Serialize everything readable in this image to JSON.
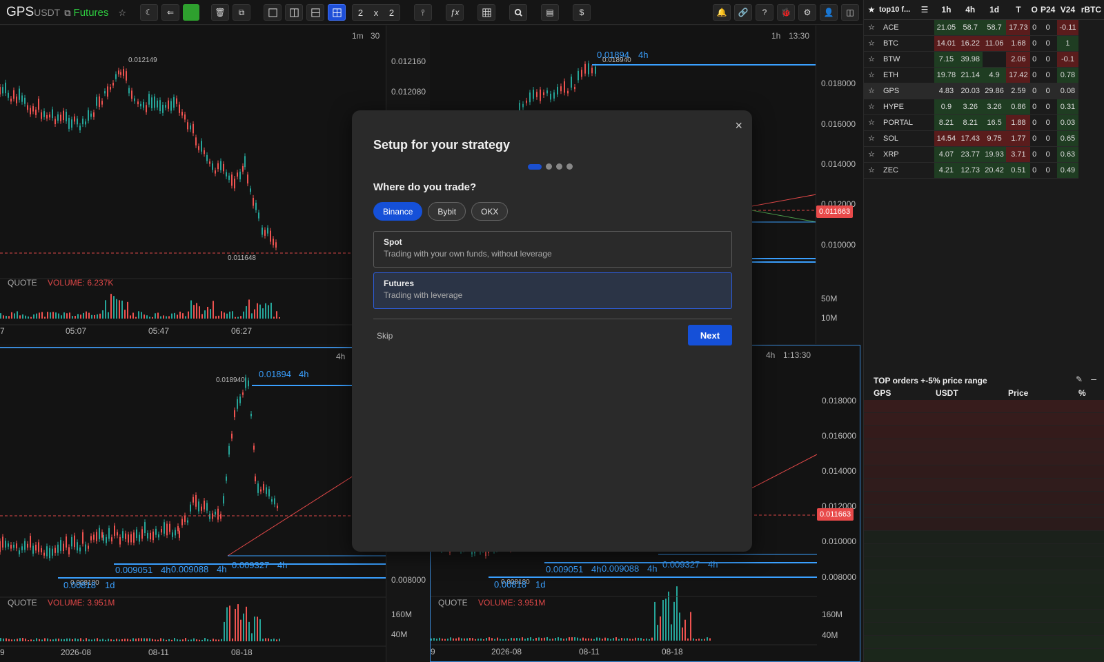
{
  "symbol": {
    "base": "GPS",
    "quote": "USDT",
    "market": "Futures"
  },
  "layout": {
    "rows": "2",
    "x": "x",
    "cols": "2"
  },
  "dollar": "$",
  "panes": {
    "tl": {
      "timeframe": "1m",
      "ticks": "30",
      "high_label": "0.012149",
      "low_label": "0.011648",
      "axis": [
        "0.012160",
        "0.012080"
      ],
      "quote": "QUOTE",
      "volume": "VOLUME: 6.237K",
      "times": [
        "7",
        "05:07",
        "05:47",
        "06:27"
      ]
    },
    "tr": {
      "timeframe": "1h",
      "countdown": "13:30",
      "level": "0.01894",
      "level_tf": "4h",
      "high_label": "0.018940",
      "axis": [
        "0.018000",
        "0.016000",
        "0.014000",
        "0.012000",
        "0.010000"
      ],
      "price_tag": "0.011663",
      "vol_axis": [
        "50M",
        "10M"
      ]
    },
    "bl": {
      "timeframe": "4h",
      "level": "0.01894",
      "level_tf": "4h",
      "high_label": "0.018940",
      "low_label": "0.008180",
      "l1": "0.009051",
      "l1_tf": "4h",
      "l2": "0.009088",
      "l2_tf": "4h",
      "l3": "0.009327",
      "l3_tf": "4h",
      "l4": "0.00818",
      "l4_tf": "1d",
      "axis": [
        "0.008000"
      ],
      "quote": "QUOTE",
      "volume": "VOLUME: 3.951M",
      "vol_axis": [
        "160M",
        "40M"
      ],
      "times": [
        "9",
        "2026-08",
        "08-11",
        "08-18"
      ]
    },
    "br": {
      "timeframe": "4h",
      "countdown": "1:13:30",
      "axis": [
        "0.018000",
        "0.016000",
        "0.014000",
        "0.012000",
        "0.010000",
        "0.008000"
      ],
      "price_tag": "0.011663",
      "low_label": "0.008180",
      "l1": "0.009051",
      "l1_tf": "4h",
      "l2": "0.009088",
      "l2_tf": "4h",
      "l3": "0.009327",
      "l3_tf": "4h",
      "l4": "0.00818",
      "l4_tf": "1d",
      "quote": "QUOTE",
      "volume": "VOLUME: 3.951M",
      "vol_axis": [
        "160M",
        "40M"
      ],
      "times": [
        "9",
        "2026-08",
        "08-11",
        "08-18"
      ]
    }
  },
  "watchlist": {
    "title": "top10 f...",
    "headers": [
      "1h",
      "4h",
      "1d",
      "T",
      "O",
      "P24",
      "V24",
      "rBTC"
    ],
    "rows": [
      {
        "name": "ACE",
        "v": [
          "21.05",
          "58.7",
          "58.7",
          "17.73",
          "0",
          "0",
          "-0.11"
        ]
      },
      {
        "name": "BTC",
        "v": [
          "14.01",
          "16.22",
          "11.06",
          "1.68",
          "0",
          "0",
          "1"
        ]
      },
      {
        "name": "BTW",
        "v": [
          "7.15",
          "39.98",
          "",
          "2.06",
          "0",
          "0",
          "-0.1"
        ]
      },
      {
        "name": "ETH",
        "v": [
          "19.78",
          "21.14",
          "4.9",
          "17.42",
          "0",
          "0",
          "0.78"
        ]
      },
      {
        "name": "GPS",
        "v": [
          "4.83",
          "20.03",
          "29.86",
          "2.59",
          "0",
          "0",
          "0.08"
        ]
      },
      {
        "name": "HYPE",
        "v": [
          "0.9",
          "3.26",
          "3.26",
          "0.86",
          "0",
          "0",
          "0.31"
        ]
      },
      {
        "name": "PORTAL",
        "v": [
          "8.21",
          "8.21",
          "16.5",
          "1.88",
          "0",
          "0",
          "0.03"
        ]
      },
      {
        "name": "SOL",
        "v": [
          "14.54",
          "17.43",
          "9.75",
          "1.77",
          "0",
          "0",
          "0.65"
        ]
      },
      {
        "name": "XRP",
        "v": [
          "4.07",
          "23.77",
          "19.93",
          "3.71",
          "0",
          "0",
          "0.63"
        ]
      },
      {
        "name": "ZEC",
        "v": [
          "4.21",
          "12.73",
          "20.42",
          "0.51",
          "0",
          "0",
          "0.49"
        ]
      }
    ]
  },
  "top_orders": {
    "title": "TOP orders +-5% price range",
    "cols": [
      "GPS",
      "USDT",
      "Price",
      "%"
    ]
  },
  "modal": {
    "title": "Setup for your strategy",
    "question": "Where do you trade?",
    "exchanges": [
      "Binance",
      "Bybit",
      "OKX"
    ],
    "spot_title": "Spot",
    "spot_desc": "Trading with your own funds, without leverage",
    "futures_title": "Futures",
    "futures_desc": "Trading with leverage",
    "skip": "Skip",
    "next": "Next",
    "close": "×"
  }
}
